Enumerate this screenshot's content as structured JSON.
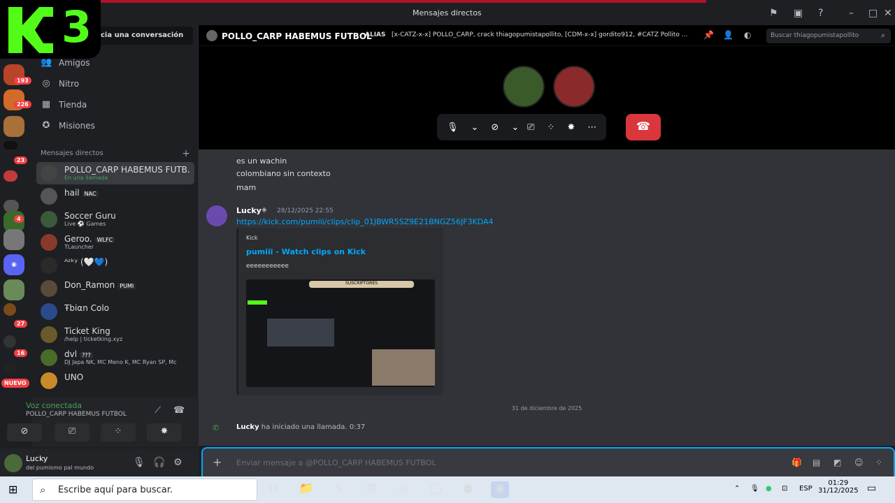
{
  "window": {
    "title": "Mensajes directos"
  },
  "dm_search": {
    "label": "cia una conversación"
  },
  "brand": {
    "overlay_text": "3"
  },
  "servers": [
    {
      "badge": "193"
    },
    {
      "badge": "226"
    },
    {
      "badge": ""
    },
    {
      "badge": ""
    },
    {
      "badge": "23"
    },
    {
      "badge": ""
    },
    {
      "badge": ""
    },
    {
      "badge": "4"
    },
    {
      "badge": ""
    },
    {
      "badge": ""
    },
    {
      "badge": ""
    },
    {
      "badge": "27"
    },
    {
      "badge": "16"
    },
    {
      "badge": ""
    }
  ],
  "servers_new": "NUEVO",
  "nav": [
    {
      "label": "Amigos",
      "icon": "friends-icon"
    },
    {
      "label": "Nitro",
      "icon": "nitro-icon"
    },
    {
      "label": "Tienda",
      "icon": "shop-icon"
    },
    {
      "label": "Misiones",
      "icon": "quests-icon"
    }
  ],
  "dm_header": "Mensajes directos",
  "dms": [
    {
      "name": "POLLO_CARP HABEMUS FUTB...",
      "sub": "En una llamada",
      "tag": ""
    },
    {
      "name": "hail",
      "sub": "",
      "tag": "NAC"
    },
    {
      "name": "Soccer Guru",
      "sub": "Live ⚽ Games",
      "tag": ""
    },
    {
      "name": "Geroo.",
      "sub": "TLauncher",
      "tag": "WLFC"
    },
    {
      "name": "ᴬᶻᵏʸ (🤍💙)",
      "sub": "",
      "tag": ""
    },
    {
      "name": "Don_Ramon",
      "sub": "",
      "tag": "PUMI"
    },
    {
      "name": "Ŧbiαn Colo",
      "sub": "",
      "tag": ""
    },
    {
      "name": "Ticket King",
      "sub": "/help | ticketking.xyz",
      "tag": ""
    },
    {
      "name": "dvl",
      "sub": "DJ Japa NK, MC Meno K, MC Ryan SP, Mc",
      "tag": "???"
    },
    {
      "name": "UNO",
      "sub": "",
      "tag": ""
    }
  ],
  "voice": {
    "status": "Voz conectada",
    "channel": "POLLO_CARP HABEMUS FUTBOL"
  },
  "user": {
    "name": "Lucky",
    "status": "del pumismo pal mundo"
  },
  "chat_header": {
    "name": "POLLO_CARP HABEMUS FUTBOL",
    "alias_label": "ALIAS",
    "alias_value": "[x-CATZ-x-x] POLLO_CARP, crack thiagopumistapollito, [CDM-x-x] gordito912, #CATZ Pollito ...",
    "search_placeholder": "Buscar thiagopumistapollito"
  },
  "messages": {
    "lines": [
      "es un wachin",
      "colombiano sin contexto",
      "mam"
    ],
    "author": "Lucky",
    "timestamp": "28/12/2025 22:55",
    "link": "https://kick.com/pumiii/clips/clip_01JBWR5SZ9E21BNGZ56JF3KDA4",
    "embed": {
      "provider": "Kick",
      "title": "pumiii - Watch clips on Kick",
      "description": "eeeeeeeeeee",
      "thumb_bar": "SUSCRIPTORES"
    },
    "day": "31 de diciembre de 2025",
    "call_author": "Lucky",
    "call_text": "ha iniciado una llamada.",
    "call_time": "0:37"
  },
  "composer": {
    "placeholder": "Enviar mensaje a @POLLO_CARP HABEMUS FUTBOL"
  },
  "taskbar": {
    "search": "Escribe aquí para buscar.",
    "lang": "ESP",
    "time": "01:29",
    "date": "31/12/2025"
  }
}
